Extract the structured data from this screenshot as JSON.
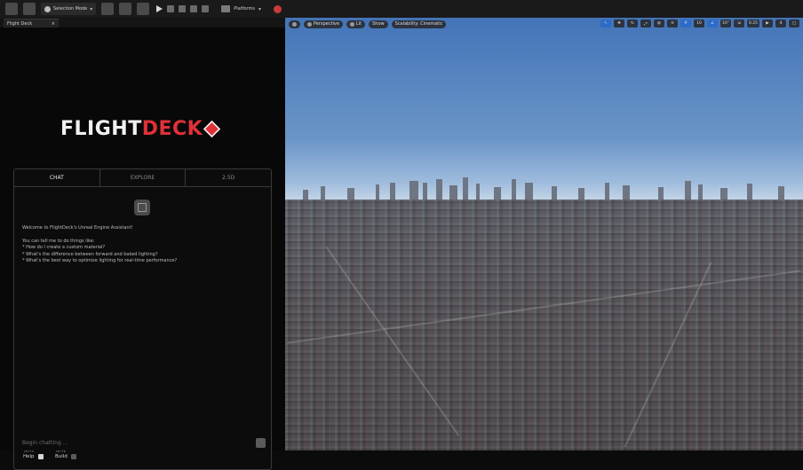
{
  "toolbar": {
    "selection_mode": "Selection Mode",
    "platforms": "Platforms"
  },
  "panel_tab": {
    "title": "Flight Deck",
    "close": "×"
  },
  "logo": {
    "word_white": "FLIGHT",
    "word_red": "DECK"
  },
  "chat": {
    "tabs": [
      "CHAT",
      "EXPLORE",
      "2.5D"
    ],
    "active_tab": "CHAT",
    "messages": {
      "welcome": "Welcome to FlightDeck's Unreal Engine Assistant!",
      "intro": "You can tell me to do things like:",
      "examples": [
        "* How do I create a custom material?",
        "* What's the difference between forward and baked lighting?",
        "* What's the best way to optimize lighting for real-time performance?"
      ]
    },
    "input_placeholder": "Begin chatting ...",
    "options": [
      {
        "key": "ctrl+h",
        "label": "Help",
        "checked": true
      },
      {
        "key": "ctrl+b",
        "label": "Build",
        "checked": false
      }
    ]
  },
  "viewport": {
    "buttons": [
      "Perspective",
      "Lit",
      "Show",
      "Scalability: Cinematic"
    ],
    "right_controls": [
      "10",
      "10°",
      "0.25",
      "4"
    ]
  }
}
